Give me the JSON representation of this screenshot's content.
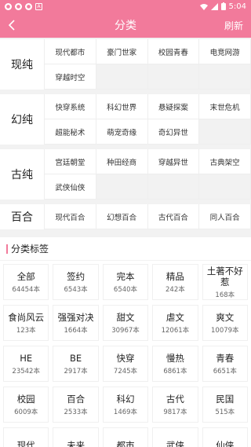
{
  "status_bar": {
    "time": "5:04",
    "icons": [
      "notification-icon",
      "notification-icon",
      "notification-icon",
      "a-icon"
    ]
  },
  "app_bar": {
    "title": "分类",
    "refresh": "刷新"
  },
  "groups": [
    {
      "name": "现纯",
      "items": [
        "现代都市",
        "豪门世家",
        "校园青春",
        "电竞网游",
        "穿越时空"
      ]
    },
    {
      "name": "幻纯",
      "items": [
        "快穿系统",
        "科幻世界",
        "悬疑探案",
        "末世危机",
        "超能秘术",
        "萌宠奇缘",
        "奇幻异世"
      ]
    },
    {
      "name": "古纯",
      "items": [
        "宫廷朝堂",
        "种田经商",
        "穿越异世",
        "古典架空",
        "武侠仙侠"
      ]
    },
    {
      "name": "百合",
      "items": [
        "现代百合",
        "幻想百合",
        "古代百合",
        "同人百合"
      ]
    }
  ],
  "tags_section": {
    "title": "分类标签"
  },
  "tags": [
    {
      "name": "全部",
      "count": "64454本"
    },
    {
      "name": "签约",
      "count": "6543本"
    },
    {
      "name": "完本",
      "count": "6540本"
    },
    {
      "name": "精品",
      "count": "242本"
    },
    {
      "name": "土著不好惹",
      "count": "168本"
    },
    {
      "name": "食尚风云",
      "count": "123本"
    },
    {
      "name": "强强对决",
      "count": "1664本"
    },
    {
      "name": "甜文",
      "count": "30967本"
    },
    {
      "name": "虐文",
      "count": "12061本"
    },
    {
      "name": "爽文",
      "count": "10079本"
    },
    {
      "name": "HE",
      "count": "23542本"
    },
    {
      "name": "BE",
      "count": "2917本"
    },
    {
      "name": "快穿",
      "count": "7245本"
    },
    {
      "name": "慢热",
      "count": "6861本"
    },
    {
      "name": "青春",
      "count": "6651本"
    },
    {
      "name": "校园",
      "count": "6009本"
    },
    {
      "name": "百合",
      "count": "2533本"
    },
    {
      "name": "科幻",
      "count": "1469本"
    },
    {
      "name": "古代",
      "count": "9817本"
    },
    {
      "name": "民国",
      "count": "515本"
    },
    {
      "name": "现代",
      "count": ""
    },
    {
      "name": "未来",
      "count": ""
    },
    {
      "name": "都市",
      "count": ""
    },
    {
      "name": "武侠",
      "count": ""
    },
    {
      "name": "仙侠",
      "count": ""
    }
  ],
  "colors": {
    "accent": "#f27a9b",
    "background": "#f2f2f2"
  }
}
